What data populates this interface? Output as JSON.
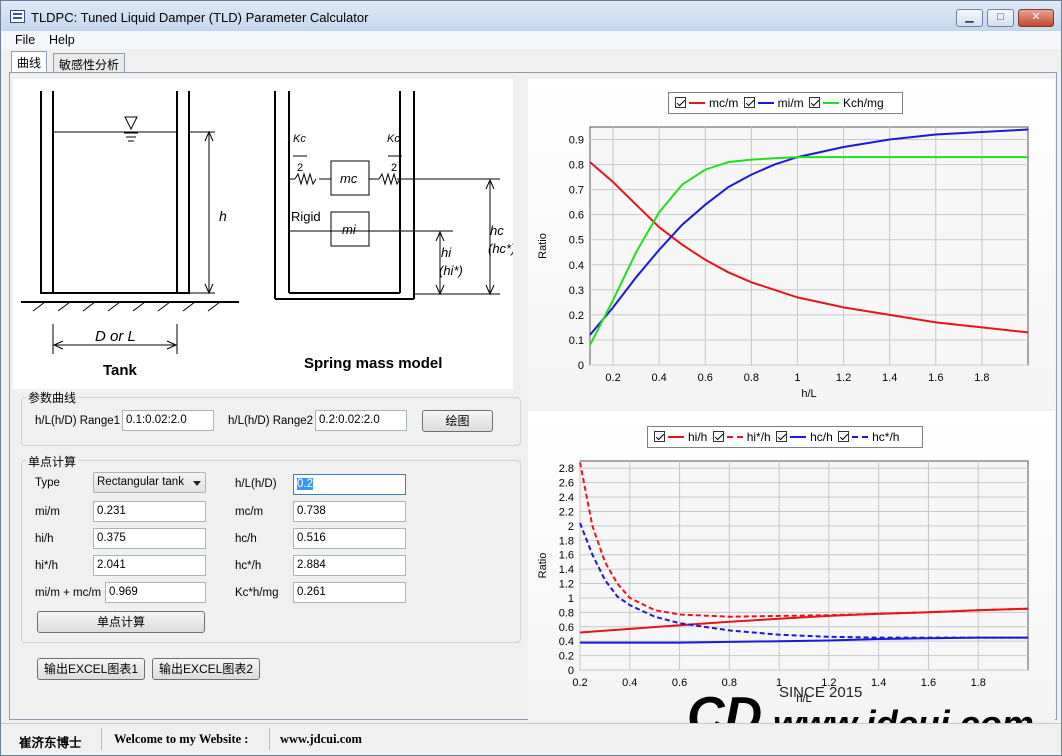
{
  "window": {
    "title": "TLDPC: Tuned Liquid Damper (TLD) Parameter Calculator",
    "minimize": "▁",
    "maximize": "□",
    "close": "✕"
  },
  "menu": {
    "file": "File",
    "help": "Help"
  },
  "tabs": [
    {
      "label": "曲线"
    },
    {
      "label": "敏感性分析"
    }
  ],
  "diagram": {
    "tank_label": "Tank",
    "width_label": "D or L",
    "height_label": "h",
    "model_label": "Spring mass model",
    "kc_label": "Kc",
    "kc_div": "2",
    "mc_label": "mc",
    "mi_label": "mi",
    "rigid_label": "Rigid",
    "hi_label": "hi",
    "hi_star_label": "(hi*)",
    "hc_label": "hc",
    "hc_star_label": "(hc*)"
  },
  "param_curve": {
    "title": "参数曲线",
    "range1_label": "h/L(h/D) Range1",
    "range1_value": "0.1:0.02:2.0",
    "range2_label": "h/L(h/D) Range2",
    "range2_value": "0.2:0.02:2.0",
    "plot_button": "绘图"
  },
  "single_point": {
    "title": "单点计算",
    "type_label": "Type",
    "type_value": "Rectangular tank",
    "hl_label": "h/L(h/D)",
    "hl_value": "0.2",
    "mi_m_label": "mi/m",
    "mi_m_value": "0.231",
    "mc_m_label": "mc/m",
    "mc_m_value": "0.738",
    "hi_h_label": "hi/h",
    "hi_h_value": "0.375",
    "hc_h_label": "hc/h",
    "hc_h_value": "0.516",
    "hi_star_label": "hi*/h",
    "hi_star_value": "2.041",
    "hc_star_label": "hc*/h",
    "hc_star_value": "2.884",
    "sum_label": "mi/m + mc/m",
    "sum_value": "0.969",
    "kc_label": "Kc*h/mg",
    "kc_value": "0.261",
    "calc_button": "单点计算"
  },
  "export": {
    "btn1": "输出EXCEL图表1",
    "btn2": "输出EXCEL图表2"
  },
  "status": {
    "author": "崔济东博士",
    "welcome": "Welcome to my Website :",
    "url": "www.jdcui.com"
  },
  "brand": {
    "since": "SINCE 2015",
    "logo": "CD",
    "url": "www.jdcui.com"
  },
  "colors": {
    "red": "#e8141c",
    "blue": "#1a1ad8",
    "green": "#1fe01f",
    "grid": "#c8c8c8"
  },
  "chart_data": [
    {
      "type": "line",
      "xlabel": "h/L",
      "ylabel": "Ratio",
      "xlim": [
        0.1,
        2.0
      ],
      "ylim": [
        0,
        0.95
      ],
      "xticks": [
        "0.2",
        "0.4",
        "0.6",
        "0.8",
        "1",
        "1.2",
        "1.4",
        "1.6",
        "1.8"
      ],
      "yticks": [
        "0",
        "0.1",
        "0.2",
        "0.3",
        "0.4",
        "0.5",
        "0.6",
        "0.7",
        "0.8",
        "0.9"
      ],
      "grid": true,
      "legend": "top-center",
      "series": [
        {
          "name": "mc/m",
          "color": "red",
          "dash": false,
          "x": [
            0.1,
            0.2,
            0.3,
            0.4,
            0.5,
            0.6,
            0.7,
            0.8,
            0.9,
            1.0,
            1.2,
            1.4,
            1.6,
            1.8,
            2.0
          ],
          "y": [
            0.81,
            0.73,
            0.64,
            0.55,
            0.48,
            0.42,
            0.37,
            0.33,
            0.3,
            0.27,
            0.23,
            0.2,
            0.17,
            0.15,
            0.13
          ]
        },
        {
          "name": "mi/m",
          "color": "blue",
          "dash": false,
          "x": [
            0.1,
            0.2,
            0.3,
            0.4,
            0.5,
            0.6,
            0.7,
            0.8,
            0.9,
            1.0,
            1.2,
            1.4,
            1.6,
            1.8,
            2.0
          ],
          "y": [
            0.12,
            0.23,
            0.35,
            0.46,
            0.56,
            0.64,
            0.71,
            0.76,
            0.8,
            0.83,
            0.87,
            0.9,
            0.92,
            0.93,
            0.94
          ]
        },
        {
          "name": "Kch/mg",
          "color": "green",
          "dash": false,
          "x": [
            0.1,
            0.2,
            0.3,
            0.4,
            0.5,
            0.6,
            0.7,
            0.8,
            0.9,
            1.0,
            1.2,
            1.4,
            1.6,
            1.8,
            2.0
          ],
          "y": [
            0.08,
            0.26,
            0.45,
            0.61,
            0.72,
            0.78,
            0.81,
            0.82,
            0.825,
            0.83,
            0.83,
            0.83,
            0.83,
            0.83,
            0.83
          ]
        }
      ]
    },
    {
      "type": "line",
      "xlabel": "h/L",
      "ylabel": "Ratio",
      "xlim": [
        0.2,
        2.0
      ],
      "ylim": [
        0,
        2.9
      ],
      "xticks": [
        "0.2",
        "0.4",
        "0.6",
        "0.8",
        "1",
        "1.2",
        "1.4",
        "1.6",
        "1.8"
      ],
      "yticks": [
        "0",
        "0.2",
        "0.4",
        "0.6",
        "0.8",
        "1",
        "1.2",
        "1.4",
        "1.6",
        "1.8",
        "2",
        "2.2",
        "2.4",
        "2.6",
        "2.8"
      ],
      "grid": true,
      "legend": "top-center",
      "series": [
        {
          "name": "hi/h",
          "color": "red",
          "dash": false,
          "x": [
            0.2,
            0.4,
            0.6,
            0.8,
            1.0,
            1.2,
            1.4,
            1.6,
            1.8,
            2.0
          ],
          "y": [
            0.52,
            0.57,
            0.62,
            0.67,
            0.71,
            0.75,
            0.78,
            0.8,
            0.83,
            0.85
          ]
        },
        {
          "name": "hi*/h",
          "color": "red",
          "dash": true,
          "x": [
            0.2,
            0.25,
            0.3,
            0.35,
            0.4,
            0.5,
            0.6,
            0.8,
            1.0,
            1.2,
            1.4,
            1.6,
            1.8,
            2.0
          ],
          "y": [
            2.88,
            2.0,
            1.5,
            1.2,
            1.0,
            0.83,
            0.77,
            0.74,
            0.75,
            0.76,
            0.78,
            0.8,
            0.83,
            0.85
          ]
        },
        {
          "name": "hc/h",
          "color": "blue",
          "dash": false,
          "x": [
            0.2,
            0.4,
            0.6,
            0.8,
            1.0,
            1.2,
            1.4,
            1.6,
            1.8,
            2.0
          ],
          "y": [
            0.38,
            0.38,
            0.38,
            0.39,
            0.4,
            0.41,
            0.43,
            0.44,
            0.45,
            0.45
          ]
        },
        {
          "name": "hc*/h",
          "color": "blue",
          "dash": true,
          "x": [
            0.2,
            0.25,
            0.3,
            0.35,
            0.4,
            0.5,
            0.6,
            0.8,
            1.0,
            1.2,
            1.4,
            1.6,
            1.8,
            2.0
          ],
          "y": [
            2.04,
            1.6,
            1.25,
            1.02,
            0.9,
            0.74,
            0.65,
            0.55,
            0.49,
            0.46,
            0.45,
            0.45,
            0.45,
            0.45
          ]
        }
      ]
    }
  ]
}
